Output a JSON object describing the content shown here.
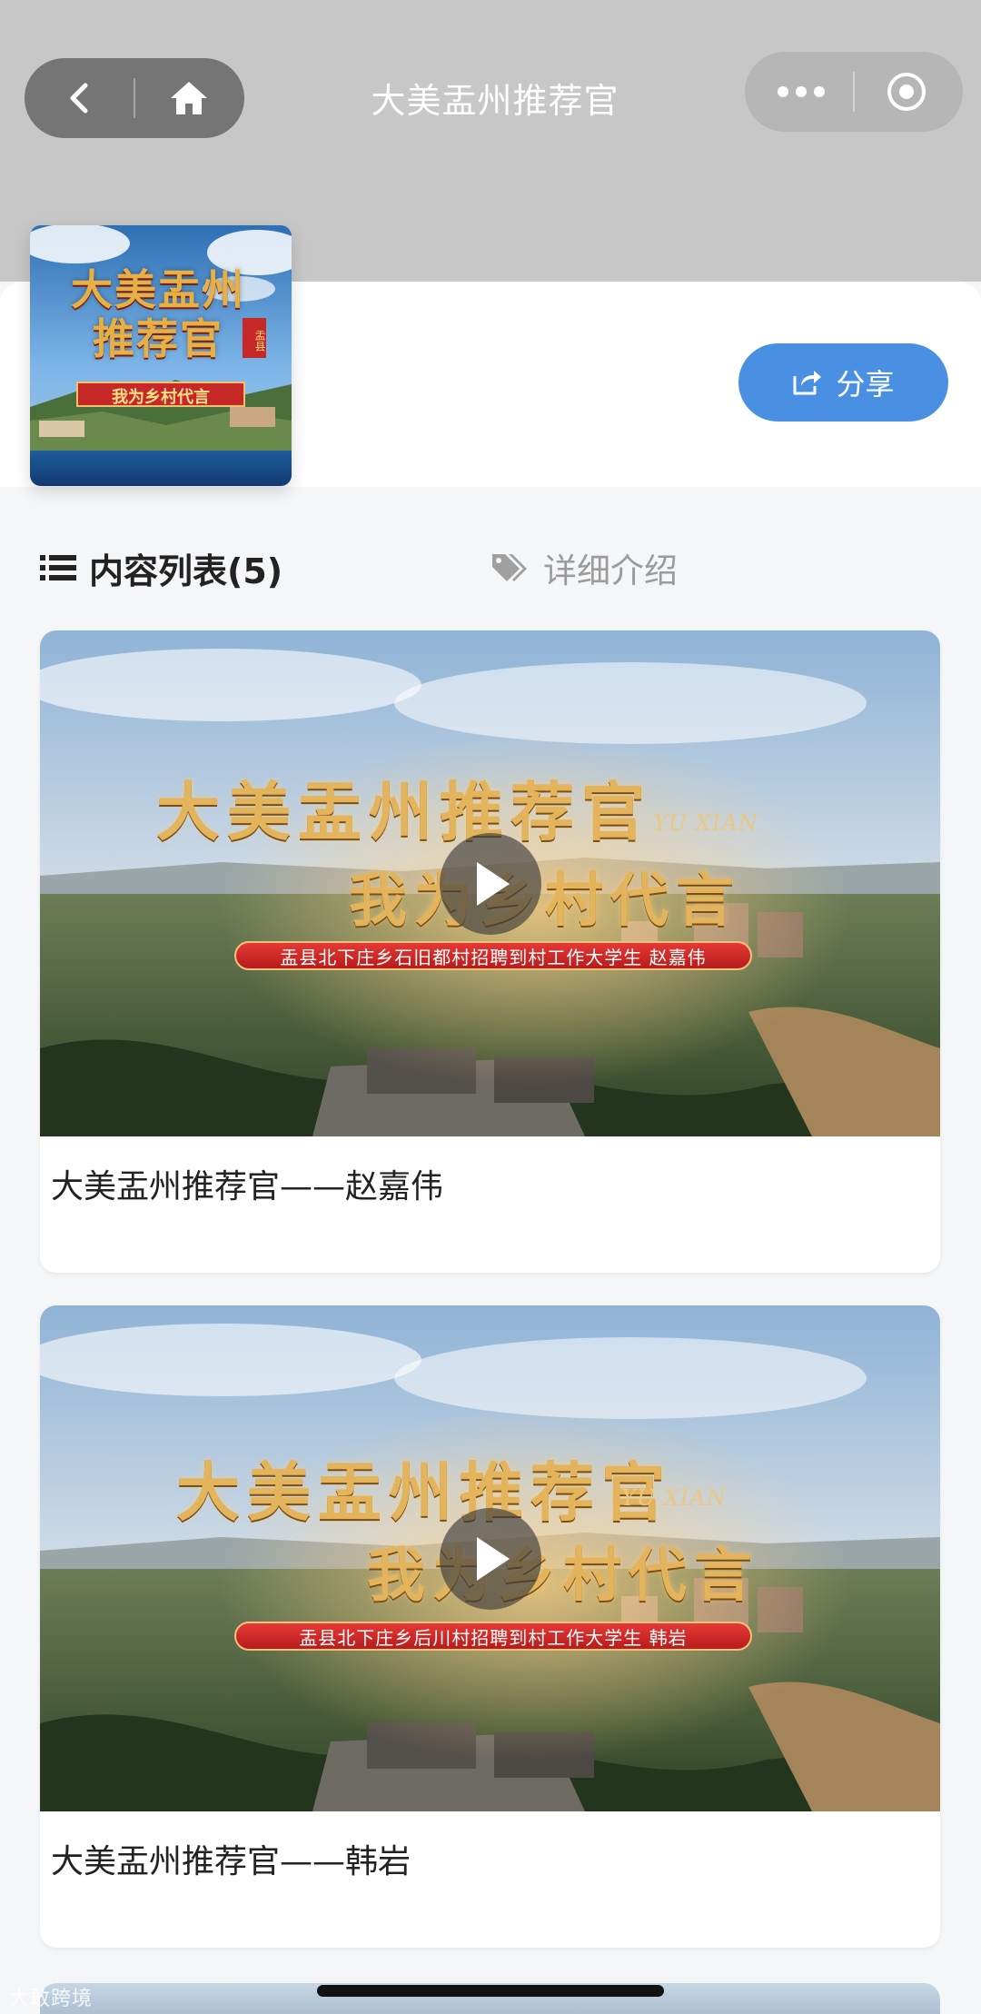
{
  "nav": {
    "title": "大美盂州推荐官",
    "back_icon": "chevron-left-icon",
    "home_icon": "home-icon",
    "more_icon": "more-dots-icon",
    "record_icon": "record-icon"
  },
  "header": {
    "cover_title": "大美盂州推荐官",
    "cover_subtitle": "我为乡村代言",
    "cover_badge": "盂县",
    "share_label": "分享",
    "share_icon": "share-icon"
  },
  "tabs": [
    {
      "label": "内容列表(5)",
      "icon": "list-icon",
      "active": true
    },
    {
      "label": "详细介绍",
      "icon": "tags-icon",
      "active": false
    }
  ],
  "videos": [
    {
      "title": "大美盂州推荐官——赵嘉伟",
      "thumb_title": "大美盂州推荐官",
      "thumb_line2": "我为乡村代言",
      "thumb_yx": "YU XIAN",
      "thumb_banner": "盂县北下庄乡石旧都村招聘到村工作大学生 赵嘉伟"
    },
    {
      "title": "大美盂州推荐官——韩岩",
      "thumb_title": "大美盂州推荐官",
      "thumb_line2": "我为乡村代言",
      "thumb_yx": "YU XIAN",
      "thumb_banner": "盂县北下庄乡后川村招聘到村工作大学生 韩岩"
    }
  ],
  "watermark": "大敢跨境",
  "colors": {
    "accent": "#4a90e2",
    "top_bg": "#c7c7c7",
    "page_bg": "#f5f6f8",
    "gold": "#e3b45c",
    "red_banner": "#d32f2f"
  }
}
